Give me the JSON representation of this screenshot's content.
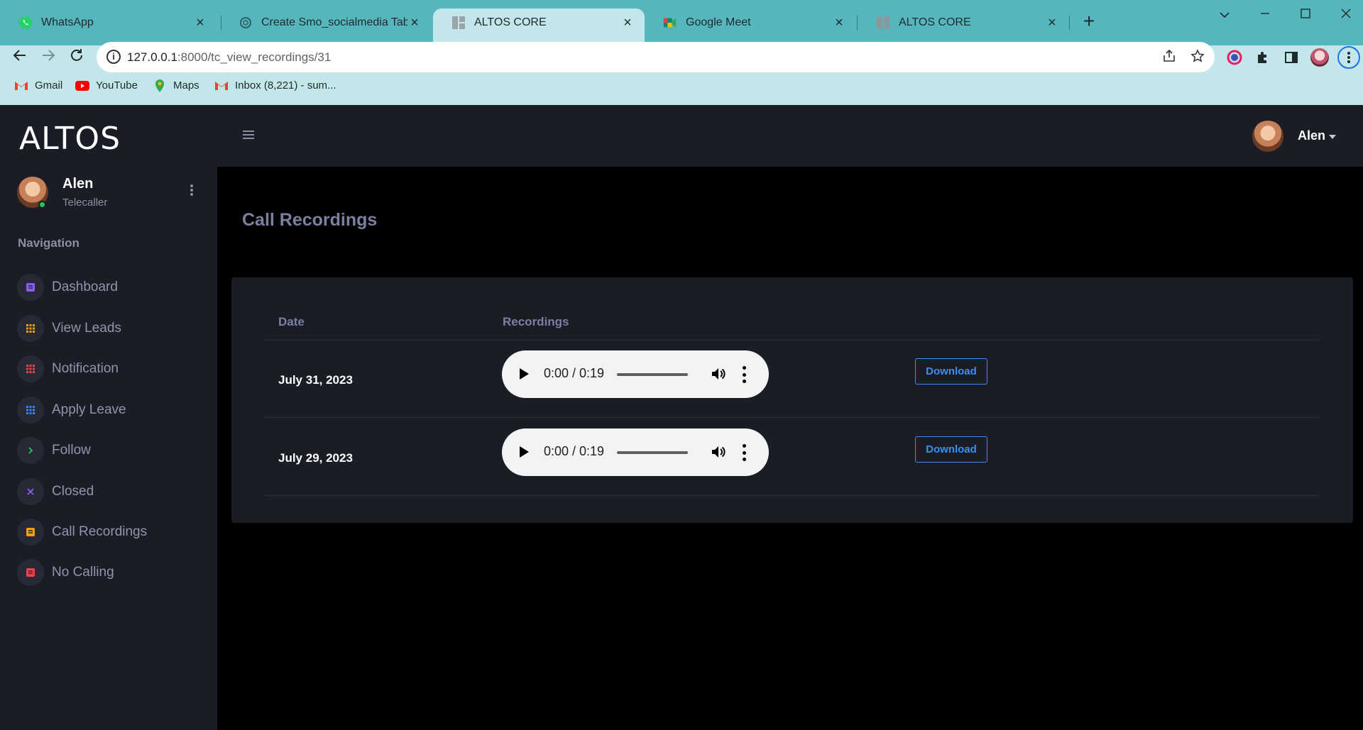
{
  "browser": {
    "tabs": [
      {
        "title": "WhatsApp",
        "icon": "whatsapp-icon"
      },
      {
        "title": "Create Smo_socialmedia Table.",
        "icon": "chatgpt-icon"
      },
      {
        "title": "ALTOS CORE",
        "icon": "page-icon",
        "active": true
      },
      {
        "title": "Google Meet",
        "icon": "google-meet-icon"
      },
      {
        "title": "ALTOS CORE",
        "icon": "page-icon"
      }
    ],
    "new_tab_symbol": "+",
    "address": {
      "host": "127.0.0.1",
      "rest": ":8000/tc_view_recordings/31"
    },
    "bookmarks": [
      {
        "label": "Gmail",
        "icon": "gmail-icon"
      },
      {
        "label": "YouTube",
        "icon": "youtube-icon"
      },
      {
        "label": "Maps",
        "icon": "maps-icon"
      },
      {
        "label": "Inbox (8,221) - sum...",
        "icon": "gmail-icon"
      }
    ]
  },
  "app": {
    "brand": "ALTOS",
    "user": {
      "name": "Alen",
      "role": "Telecaller"
    },
    "nav_title": "Navigation",
    "nav": [
      {
        "label": "Dashboard",
        "icon": "document-icon",
        "color": "#8b5cf6"
      },
      {
        "label": "View Leads",
        "icon": "grid-icon",
        "color": "#f59e0b"
      },
      {
        "label": "Notification",
        "icon": "grid-icon",
        "color": "#ef4444"
      },
      {
        "label": "Apply Leave",
        "icon": "grid-icon",
        "color": "#3b82f6"
      },
      {
        "label": "Follow",
        "icon": "chevron-right-icon",
        "color": "#22c55e"
      },
      {
        "label": "Closed",
        "icon": "x-icon",
        "color": "#8b5cf6"
      },
      {
        "label": "Call Recordings",
        "icon": "document-icon",
        "color": "#f59e0b"
      },
      {
        "label": "No Calling",
        "icon": "document-icon",
        "color": "#ef4444"
      }
    ],
    "topbar_user": "Alen",
    "page_title": "Call Recordings",
    "table": {
      "headers": [
        "Date",
        "Recordings"
      ],
      "rows": [
        {
          "date": "July 31, 2023",
          "time": "0:00 / 0:19",
          "action": "Download"
        },
        {
          "date": "July 29, 2023",
          "time": "0:00 / 0:19",
          "action": "Download"
        }
      ]
    }
  }
}
